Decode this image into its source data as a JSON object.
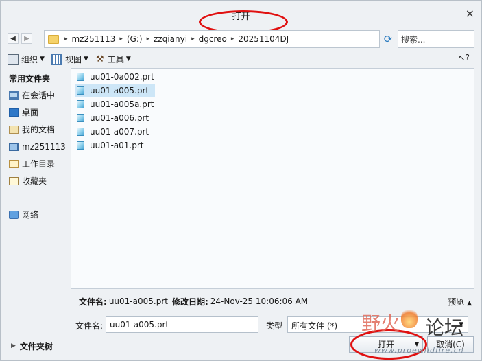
{
  "window": {
    "title": "打开",
    "close_symbol": "×"
  },
  "address": {
    "crumbs": [
      "mz251113",
      "(G:)",
      "zzqianyi",
      "dgcreo",
      "20251104DJ"
    ],
    "separator": "▸",
    "search_placeholder": "搜索..."
  },
  "toolbar": {
    "organize": "组织",
    "view": "视图",
    "tools": "工具",
    "help": "?"
  },
  "sidebar": {
    "header": "常用文件夹",
    "items": [
      "在会话中",
      "桌面",
      "我的文档",
      "mz251113",
      "工作目录",
      "收藏夹"
    ],
    "network": "网络",
    "folder_tree": "文件夹树"
  },
  "files": [
    "uu01-0a002.prt",
    "uu01-a005.prt",
    "uu01-a005a.prt",
    "uu01-a006.prt",
    "uu01-a007.prt",
    "uu01-a01.prt"
  ],
  "selected_file": "uu01-a005.prt",
  "details": {
    "name_label": "文件名:",
    "name_value": "uu01-a005.prt",
    "modified_label": "修改日期:",
    "modified_value": "24-Nov-25 10:06:06 AM",
    "preview": "预览"
  },
  "form": {
    "filename_label": "文件名:",
    "filename_value": "uu01-a005.prt",
    "type_label": "类型",
    "type_value": "所有文件 (*)"
  },
  "buttons": {
    "open": "打开",
    "cancel": "取消(C)"
  },
  "watermark": {
    "left": "野火",
    "right": "论坛",
    "url": "www.proewildfire.cn"
  },
  "colors": {
    "annotation": "#e01010",
    "selection": "#cde6f7"
  }
}
